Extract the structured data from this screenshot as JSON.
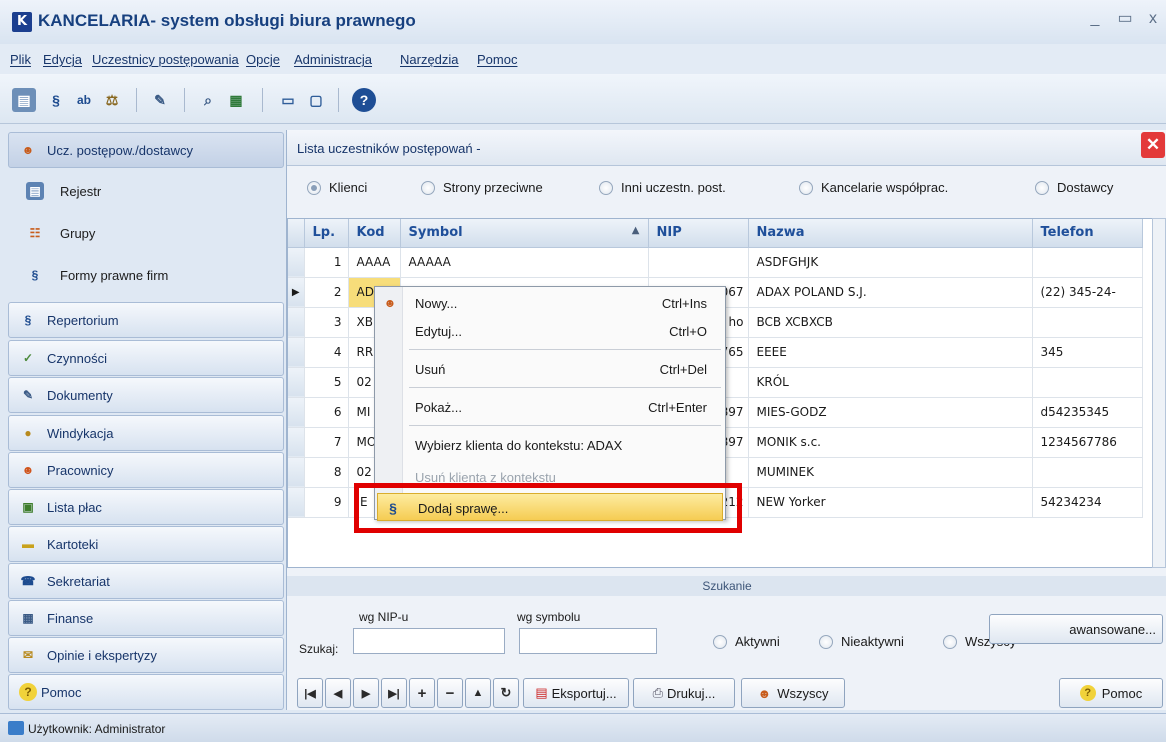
{
  "window": {
    "title": "KANCELARIA- system obsługi biura prawnego",
    "logo": "K"
  },
  "menu": [
    "Plik",
    "Edycja",
    "Uczestnicy postępowania",
    "Opcje",
    "Administracja",
    "Narzędzia",
    "Pomoc"
  ],
  "sidebar": {
    "items": [
      {
        "label": "Ucz. postępow./dostawcy",
        "icon": "people-icon",
        "active": true
      },
      {
        "label": "Rejestr",
        "icon": "register-icon",
        "sub": true
      },
      {
        "label": "Grupy",
        "icon": "groups-icon",
        "sub": true
      },
      {
        "label": "Formy prawne firm",
        "icon": "paragraph-people-icon",
        "sub": true
      },
      {
        "label": "Repertorium",
        "icon": "paragraph-icon"
      },
      {
        "label": "Czynności",
        "icon": "tasks-icon"
      },
      {
        "label": "Dokumenty",
        "icon": "documents-icon"
      },
      {
        "label": "Windykacja",
        "icon": "collection-icon"
      },
      {
        "label": "Pracownicy",
        "icon": "employees-icon"
      },
      {
        "label": "Lista płac",
        "icon": "payroll-icon"
      },
      {
        "label": "Kartoteki",
        "icon": "files-icon"
      },
      {
        "label": "Sekretariat",
        "icon": "secretariat-icon"
      },
      {
        "label": "Finanse",
        "icon": "finance-icon"
      },
      {
        "label": "Opinie i ekspertyzy",
        "icon": "opinions-icon"
      },
      {
        "label": "Pomoc",
        "icon": "help-icon"
      }
    ]
  },
  "panel": {
    "title": "Lista uczestników postępowań -",
    "filters": [
      "Klienci",
      "Strony przeciwne",
      "Inni uczestn. post.",
      "Kancelarie współprac.",
      "Dostawcy"
    ],
    "selected_filter": "Klienci",
    "columns": [
      "Lp.",
      "Kod",
      "Symbol",
      "NIP",
      "Nazwa",
      "Telefon"
    ],
    "rows": [
      {
        "lp": "1",
        "kod": "AAAA",
        "symbol": "AAAAA",
        "nip": "",
        "nazwa": "ASDFGHJK",
        "telefon": ""
      },
      {
        "lp": "2",
        "kod": "AD",
        "symbol": "",
        "nip": "067",
        "nazwa": "ADAX POLAND S.J.",
        "telefon": "(22) 345-24-"
      },
      {
        "lp": "3",
        "kod": "XB",
        "symbol": "",
        "nip": "ho",
        "nazwa": "BCB XCBXCB",
        "telefon": ""
      },
      {
        "lp": "4",
        "kod": "RR",
        "symbol": "",
        "nip": "765",
        "nazwa": "EEEE",
        "telefon": "345"
      },
      {
        "lp": "5",
        "kod": "02",
        "symbol": "",
        "nip": "",
        "nazwa": "KRÓL",
        "telefon": ""
      },
      {
        "lp": "6",
        "kod": "MI",
        "symbol": "",
        "nip": "897",
        "nazwa": "MIES-GODZ",
        "telefon": "d54235345"
      },
      {
        "lp": "7",
        "kod": "MO",
        "symbol": "",
        "nip": "897",
        "nazwa": "MONIK s.c.",
        "telefon": "1234567786"
      },
      {
        "lp": "8",
        "kod": "02",
        "symbol": "",
        "nip": "",
        "nazwa": "MUMINEK",
        "telefon": ""
      },
      {
        "lp": "9",
        "kod": "IE",
        "symbol": "",
        "nip": "212",
        "nazwa": "NEW Yorker",
        "telefon": "54234234"
      }
    ],
    "search_label": "Szukanie",
    "search": {
      "label": "Szukaj:",
      "nip_label": "wg NIP-u",
      "symbol_label": "wg symbolu"
    },
    "status_filters": [
      "Aktywni",
      "Nieaktywni",
      "Wszyscy"
    ],
    "advanced_button": "awansowane...",
    "buttons": {
      "export": "Eksportuj...",
      "print": "Drukuj...",
      "all": "Wszyscy",
      "help": "Pomoc"
    }
  },
  "context_menu": {
    "items": [
      {
        "label": "Nowy...",
        "shortcut": "Ctrl+Ins"
      },
      {
        "label": "Edytuj...",
        "shortcut": "Ctrl+O"
      },
      {
        "label": "Usuń",
        "shortcut": "Ctrl+Del"
      },
      {
        "label": "Pokaż...",
        "shortcut": "Ctrl+Enter"
      },
      {
        "label": "Wybierz klienta do kontekstu: ADAX",
        "shortcut": ""
      },
      {
        "label": "Usuń klienta z kontekstu",
        "shortcut": ""
      },
      {
        "label": "Dodaj sprawę...",
        "shortcut": ""
      }
    ]
  },
  "status": {
    "user": "Użytkownik: Administrator"
  },
  "colors": {
    "accent": "#17407f",
    "highlight": "#f5cc52",
    "annotation": "#e00000"
  }
}
